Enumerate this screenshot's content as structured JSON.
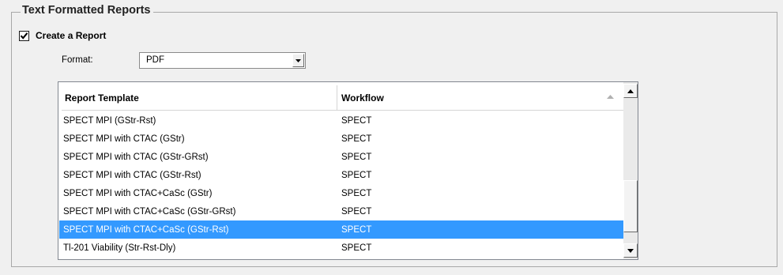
{
  "group": {
    "title": "Text Formatted Reports"
  },
  "create_report": {
    "label": "Create a Report",
    "checked": true
  },
  "format": {
    "label": "Format:",
    "value": "PDF"
  },
  "table": {
    "columns": [
      "Report Template",
      "Workflow"
    ],
    "rows": [
      {
        "template": "SPECT MPI (GStr-Rst)",
        "workflow": "SPECT"
      },
      {
        "template": "SPECT MPI with CTAC (GStr)",
        "workflow": "SPECT"
      },
      {
        "template": "SPECT MPI with CTAC (GStr-GRst)",
        "workflow": "SPECT"
      },
      {
        "template": "SPECT MPI with CTAC (GStr-Rst)",
        "workflow": "SPECT"
      },
      {
        "template": "SPECT MPI with CTAC+CaSc (GStr)",
        "workflow": "SPECT"
      },
      {
        "template": "SPECT MPI with CTAC+CaSc (GStr-GRst)",
        "workflow": "SPECT"
      },
      {
        "template": "SPECT MPI with CTAC+CaSc (GStr-Rst)",
        "workflow": "SPECT",
        "selected": true
      },
      {
        "template": "Tl-201 Viability (Str-Rst-Dly)",
        "workflow": "SPECT"
      }
    ]
  },
  "colors": {
    "selection": "#3399ff",
    "window_bg": "#f0f0f0"
  },
  "icons": {
    "checkbox": "check-icon",
    "dropdown": "chevron-down-icon",
    "sort": "sort-up-icon",
    "scroll_up": "arrow-up-icon",
    "scroll_down": "arrow-down-icon"
  }
}
